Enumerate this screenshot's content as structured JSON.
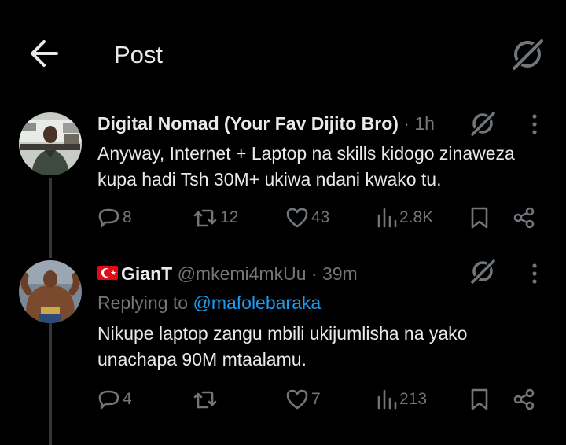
{
  "header": {
    "title": "Post"
  },
  "posts": [
    {
      "author_name": "Digital Nomad (Your Fav Dijito Bro)",
      "time": "1h",
      "text_line1": "Anyway, Internet + Laptop na skills kidogo zinaweza",
      "text_line2": "kupa hadi Tsh 30M+ ukiwa ndani kwako tu.",
      "replies": "8",
      "reposts": "12",
      "likes": "43",
      "views": "2.8K"
    },
    {
      "author_name": "GianT",
      "handle": "@mkemi4mkUu",
      "time": "39m",
      "replying_to_label": "Replying to",
      "replying_to_handle": "@mafolebaraka",
      "text_line1": "Nikupe laptop zangu mbili ukijumlisha na yako",
      "text_line2": "unachapa 90M mtaalamu.",
      "replies": "4",
      "reposts": "",
      "likes": "7",
      "views": "213"
    }
  ],
  "colors": {
    "background": "#000000",
    "text": "#e7e9ea",
    "muted": "#71767b",
    "link": "#1d9bf0",
    "divider": "#2f3336"
  }
}
